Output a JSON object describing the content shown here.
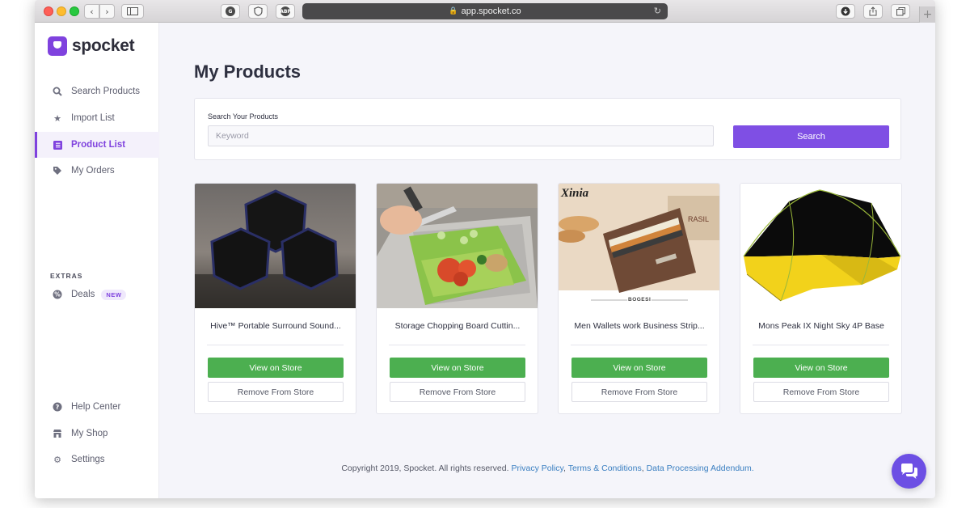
{
  "browser": {
    "url": "app.spocket.co",
    "ext_abp": "ABP"
  },
  "brand": {
    "name": "spocket",
    "accent": "#7f42de"
  },
  "sidebar": {
    "nav": [
      {
        "label": "Search Products",
        "icon": "search-icon"
      },
      {
        "label": "Import List",
        "icon": "star-icon"
      },
      {
        "label": "Product List",
        "icon": "list-icon",
        "active": true
      },
      {
        "label": "My Orders",
        "icon": "tag-icon"
      }
    ],
    "extras_label": "EXTRAS",
    "deals": {
      "label": "Deals",
      "badge": "NEW",
      "icon": "deals-icon"
    },
    "bottom": [
      {
        "label": "Help Center",
        "icon": "help-icon"
      },
      {
        "label": "My Shop",
        "icon": "shop-icon"
      },
      {
        "label": "Settings",
        "icon": "gear-icon"
      }
    ]
  },
  "main": {
    "title": "My Products",
    "search": {
      "label": "Search Your Products",
      "placeholder": "Keyword",
      "button": "Search"
    },
    "products": [
      {
        "title": "Hive™ Portable Surround Sound...",
        "view_label": "View on Store",
        "remove_label": "Remove From Store"
      },
      {
        "title": "Storage Chopping Board Cuttin...",
        "view_label": "View on Store",
        "remove_label": "Remove From Store"
      },
      {
        "title": "Men Wallets work Business Strip...",
        "view_label": "View on Store",
        "remove_label": "Remove From Store",
        "image_text": [
          "Xinia",
          "BOGESI",
          "RASIL"
        ]
      },
      {
        "title": "Mons Peak IX Night Sky 4P Base",
        "view_label": "View on Store",
        "remove_label": "Remove From Store"
      }
    ]
  },
  "footer": {
    "copyright": "Copyright 2019, Spocket. All rights reserved.",
    "privacy": "Privacy Policy",
    "terms": "Terms & Conditions",
    "dpa": "Data Processing Addendum."
  },
  "colors": {
    "primary_button": "#7f4fe4",
    "view_button": "#4caf50",
    "link": "#3a7fc1"
  }
}
